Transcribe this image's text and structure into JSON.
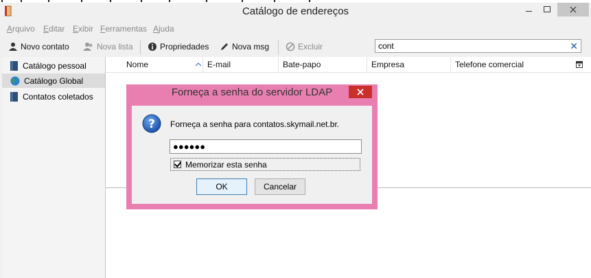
{
  "window": {
    "title": "Catálogo de endereços"
  },
  "menu": [
    {
      "label": "Arquivo"
    },
    {
      "label": "Editar"
    },
    {
      "label": "Exibir"
    },
    {
      "label": "Ferramentas"
    },
    {
      "label": "Ajuda"
    }
  ],
  "toolbar": {
    "new_contact": "Novo contato",
    "new_list": "Nova lista",
    "properties": "Propriedades",
    "new_msg": "Nova msg",
    "delete": "Excluir"
  },
  "search": {
    "value": "cont",
    "clear_icon": "close-icon"
  },
  "sidebar": {
    "items": [
      {
        "label": "Catálogo pessoal",
        "icon": "book-icon"
      },
      {
        "label": "Catálogo Global",
        "icon": "globe-icon",
        "selected": true
      },
      {
        "label": "Contatos coletados",
        "icon": "book-icon"
      }
    ]
  },
  "columns": [
    "Nome",
    "E-mail",
    "Bate-papo",
    "Empresa",
    "Telefone comercial"
  ],
  "dialog": {
    "title": "Forneça a senha do servidor LDAP",
    "message": "Forneça a senha para contatos.skymail.net.br.",
    "password_mask": "●●●●●●",
    "remember_label": "Memorizar esta senha",
    "remember_checked": true,
    "ok": "OK",
    "cancel": "Cancelar"
  },
  "colors": {
    "dialog_frame": "#e87fb0",
    "close_red": "#c9302c",
    "selection": "#dcdcdc"
  }
}
